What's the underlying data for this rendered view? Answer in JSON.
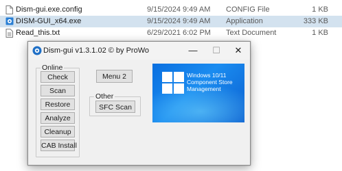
{
  "files": [
    {
      "name": "Dism-gui.exe.config",
      "date": "9/15/2024 9:49 AM",
      "type": "CONFIG File",
      "size": "1 KB",
      "icon": "document-icon",
      "selected": false
    },
    {
      "name": "DISM-GUI_x64.exe",
      "date": "9/15/2024 9:49 AM",
      "type": "Application",
      "size": "333 KB",
      "icon": "gear-app-icon",
      "selected": true
    },
    {
      "name": "Read_this.txt",
      "date": "6/29/2021 6:02 PM",
      "type": "Text Document",
      "size": "1 KB",
      "icon": "text-file-icon",
      "selected": false
    }
  ],
  "window": {
    "title": "Dism-gui v1.3.1.02    © by ProWo",
    "controls": {
      "minimize": "—",
      "maximize": "☐",
      "close": "✕"
    }
  },
  "online_group": {
    "label": "Online",
    "buttons": [
      "Check",
      "Scan",
      "Restore",
      "Analyze",
      "Cleanup",
      "CAB Install"
    ]
  },
  "menu2_label": "Menu 2",
  "other_group": {
    "label": "Other",
    "button": "SFC Scan"
  },
  "banner": {
    "text": "Windows 10/11 Component Store Management",
    "colors": {
      "background": "#0a6fe0",
      "logo": "#ffffff"
    }
  }
}
